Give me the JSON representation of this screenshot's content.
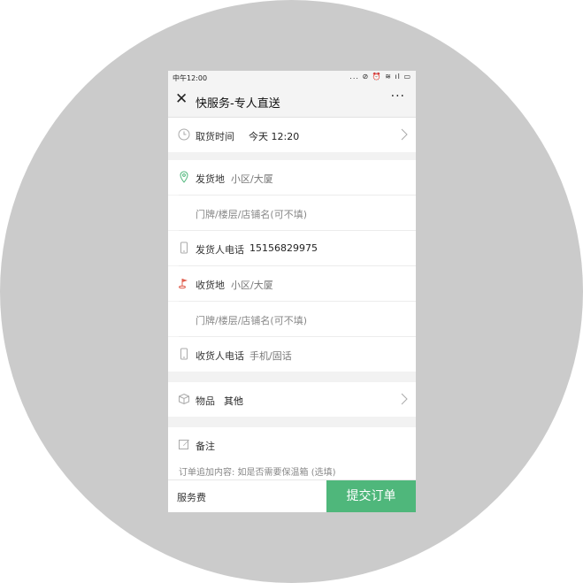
{
  "status_bar": {
    "time": "中午12:00",
    "icons": "... ⊘ ⏰ ≋ ıl ▭"
  },
  "nav": {
    "close": "✕",
    "title": "快服务-专人直送",
    "more": "···"
  },
  "pickup_time": {
    "label": "取货时间",
    "value": "今天 12:20"
  },
  "sender": {
    "address_label": "发货地",
    "address_placeholder": "小区/大厦",
    "detail_placeholder": "门牌/楼层/店铺名(可不填)",
    "phone_label": "发货人电话",
    "phone_value": "15156829975"
  },
  "receiver": {
    "address_label": "收货地",
    "address_placeholder": "小区/大厦",
    "detail_placeholder": "门牌/楼层/店铺名(可不填)",
    "phone_label": "收货人电话",
    "phone_placeholder": "手机/固话"
  },
  "item": {
    "label": "物品",
    "value": "其他"
  },
  "note": {
    "label": "备注",
    "placeholder": "订单追加内容: 如是否需要保温箱 (选填)"
  },
  "footer": {
    "fee_label": "服务费",
    "submit_label": "提交订单"
  },
  "colors": {
    "accent": "#4fb77b",
    "location_pin": "#4fb77b",
    "flag": "#e06050"
  }
}
